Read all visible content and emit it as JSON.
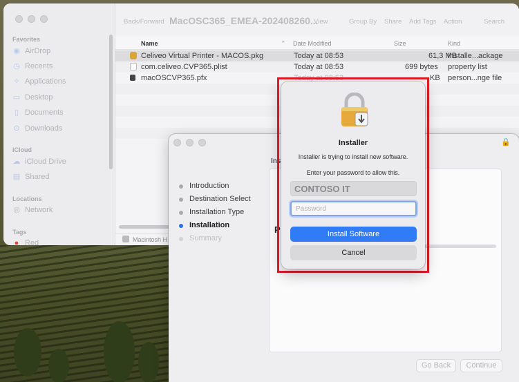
{
  "finder": {
    "toolbar": {
      "back_forward": "Back/Forward",
      "title": "MacOSC365_EMEA-202408260...",
      "view": "View",
      "group_by": "Group By",
      "share": "Share",
      "add_tags": "Add Tags",
      "action": "Action",
      "search": "Search"
    },
    "sidebar": {
      "favorites_heading": "Favorites",
      "favorites": [
        {
          "label": "AirDrop",
          "icon": "airdrop-icon"
        },
        {
          "label": "Recents",
          "icon": "clock-icon"
        },
        {
          "label": "Applications",
          "icon": "applications-icon"
        },
        {
          "label": "Desktop",
          "icon": "desktop-icon"
        },
        {
          "label": "Documents",
          "icon": "document-icon"
        },
        {
          "label": "Downloads",
          "icon": "download-icon"
        }
      ],
      "icloud_heading": "iCloud",
      "icloud": [
        {
          "label": "iCloud Drive",
          "icon": "cloud-icon"
        },
        {
          "label": "Shared",
          "icon": "shared-folder-icon"
        }
      ],
      "locations_heading": "Locations",
      "locations": [
        {
          "label": "Network",
          "icon": "network-icon"
        }
      ],
      "tags_heading": "Tags",
      "tags": [
        {
          "label": "Red",
          "color": "#e0453b"
        }
      ]
    },
    "columns": {
      "name": "Name",
      "date_modified": "Date Modified",
      "size": "Size",
      "kind": "Kind"
    },
    "files": [
      {
        "name": "Celiveo Virtual Printer - MACOS.pkg",
        "date": "Today at 08:53",
        "size": "61,3 MB",
        "kind": "Installe...ackage",
        "icon": "package-icon"
      },
      {
        "name": "com.celiveo.CVP365.plist",
        "date": "Today at 08:53",
        "size": "699 bytes",
        "kind": "property list",
        "icon": "plist-file-icon"
      },
      {
        "name": "macOSCVP365.pfx",
        "date": "Today at 08:53",
        "size": "KB",
        "kind": "person...nge file",
        "icon": "certificate-file-icon"
      }
    ],
    "path_bar": "Macintosh H"
  },
  "installer": {
    "header_partial": "Inst",
    "pane_heading_partial": "P",
    "steps": [
      {
        "label": "Introduction",
        "state": "done"
      },
      {
        "label": "Destination Select",
        "state": "done"
      },
      {
        "label": "Installation Type",
        "state": "done"
      },
      {
        "label": "Installation",
        "state": "current"
      },
      {
        "label": "Summary",
        "state": "pending"
      }
    ],
    "go_back": "Go Back",
    "continue": "Continue"
  },
  "auth_dialog": {
    "title": "Installer",
    "message": "Installer is trying to install new software.",
    "prompt": "Enter your password to allow this.",
    "username": "CONTOSO IT",
    "password_placeholder": "Password",
    "primary_button": "Install Software",
    "cancel_button": "Cancel",
    "icon": "lock-installer-icon",
    "highlight_color": "#e01e26",
    "accent_color": "#2f7cf6"
  }
}
